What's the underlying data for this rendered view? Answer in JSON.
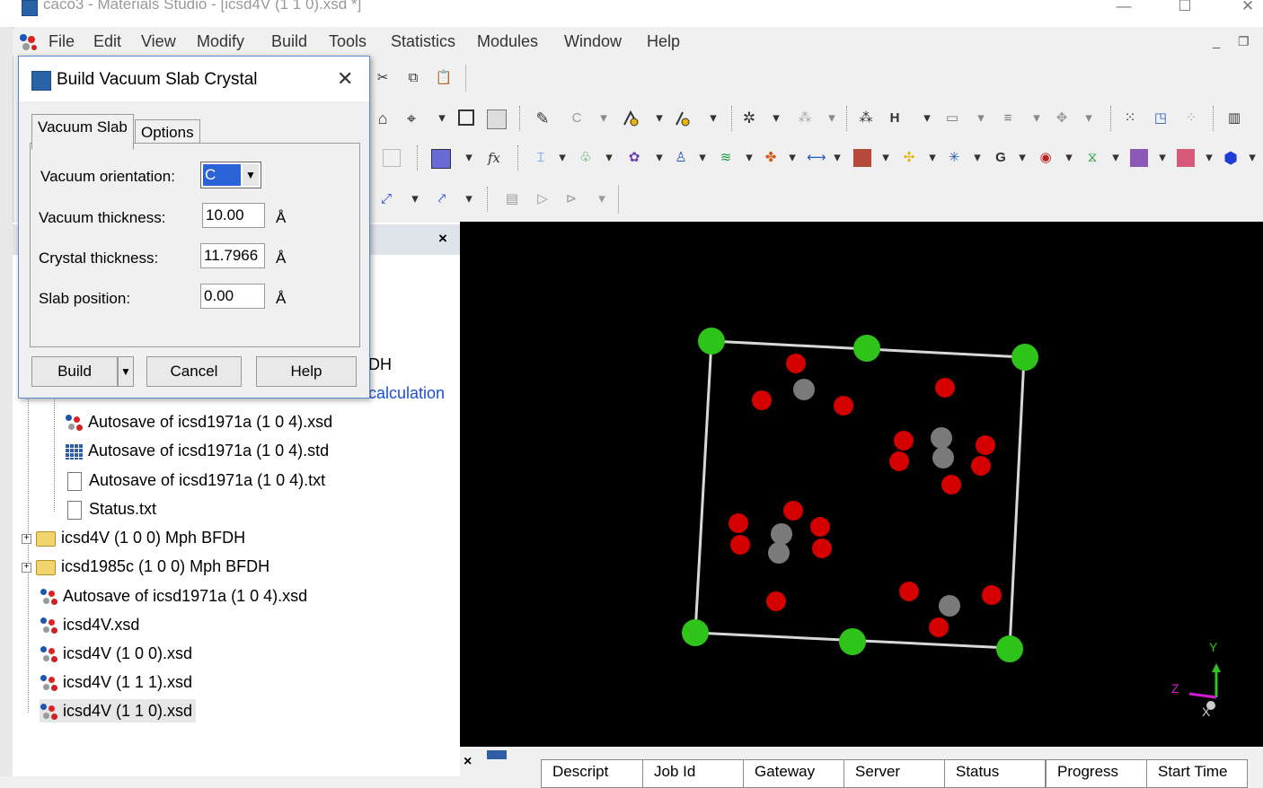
{
  "window": {
    "title": "caco3 - Materials Studio - [icsd4V (1 1 0).xsd *]",
    "minimize": "—",
    "maximize": "☐",
    "close": "✕"
  },
  "menu": {
    "items": [
      "File",
      "Edit",
      "View",
      "Modify",
      "Build",
      "Tools",
      "Statistics",
      "Modules",
      "Window",
      "Help"
    ],
    "mdi_min": "_",
    "mdi_restore": "❐"
  },
  "dialog": {
    "title": "Build Vacuum Slab Crystal",
    "close": "✕",
    "tabs": [
      "Vacuum Slab",
      "Options"
    ],
    "fields": {
      "vacuum_orientation": {
        "label": "Vacuum orientation:",
        "value": "C"
      },
      "vacuum_thickness": {
        "label": "Vacuum thickness:",
        "value": "10.00",
        "unit": "Å"
      },
      "crystal_thickness": {
        "label": "Crystal thickness:",
        "value": "11.7966",
        "unit": "Å"
      },
      "slab_position": {
        "label": "Slab position:",
        "value": "0.00",
        "unit": "Å"
      }
    },
    "buttons": {
      "build": "Build",
      "cancel": "Cancel",
      "help": "Help"
    }
  },
  "explorer": {
    "close": "×",
    "partial_labels": {
      "dh": "DH",
      "calculation": "calculation"
    },
    "items": [
      {
        "label": "Autosave of icsd1971a (1 0 4).xsd",
        "icon": "molecule"
      },
      {
        "label": "Autosave of icsd1971a (1 0 4).std",
        "icon": "table"
      },
      {
        "label": "Autosave of icsd1971a (1 0 4).txt",
        "icon": "document"
      },
      {
        "label": "Status.txt",
        "icon": "document"
      },
      {
        "label": "icsd4V (1 0 0) Mph BFDH",
        "icon": "folder",
        "expand": "+"
      },
      {
        "label": "icsd1985c (1 0 0) Mph BFDH",
        "icon": "folder",
        "expand": "+"
      },
      {
        "label": "Autosave of icsd1971a (1 0 4).xsd",
        "icon": "molecule"
      },
      {
        "label": "icsd4V.xsd",
        "icon": "molecule"
      },
      {
        "label": "icsd4V (1 0 0).xsd",
        "icon": "molecule"
      },
      {
        "label": "icsd4V (1 1 1).xsd",
        "icon": "molecule"
      },
      {
        "label": "icsd4V (1 1 0).xsd",
        "icon": "molecule"
      }
    ]
  },
  "viewer": {
    "axes": {
      "y": "Y",
      "z": "Z",
      "x": "X"
    },
    "colors": {
      "calcium": "#2ec41a",
      "oxygen": "#d40000",
      "carbon": "#7a7a7a",
      "cell": "#d8d8d8"
    }
  },
  "jobs": {
    "close": "×",
    "columns": [
      "Descript",
      "Job Id",
      "Gateway",
      "Server",
      "Status",
      "Progress",
      "Start Time"
    ]
  },
  "toolbar": {
    "glyphs": {
      "cut": "✂",
      "copy": "⧉",
      "paste": "📋",
      "home": "⌂",
      "target": "⌖",
      "bond": "✎",
      "label_c": "C",
      "fx": "fx",
      "play": "▷",
      "arrow": "▾"
    }
  }
}
